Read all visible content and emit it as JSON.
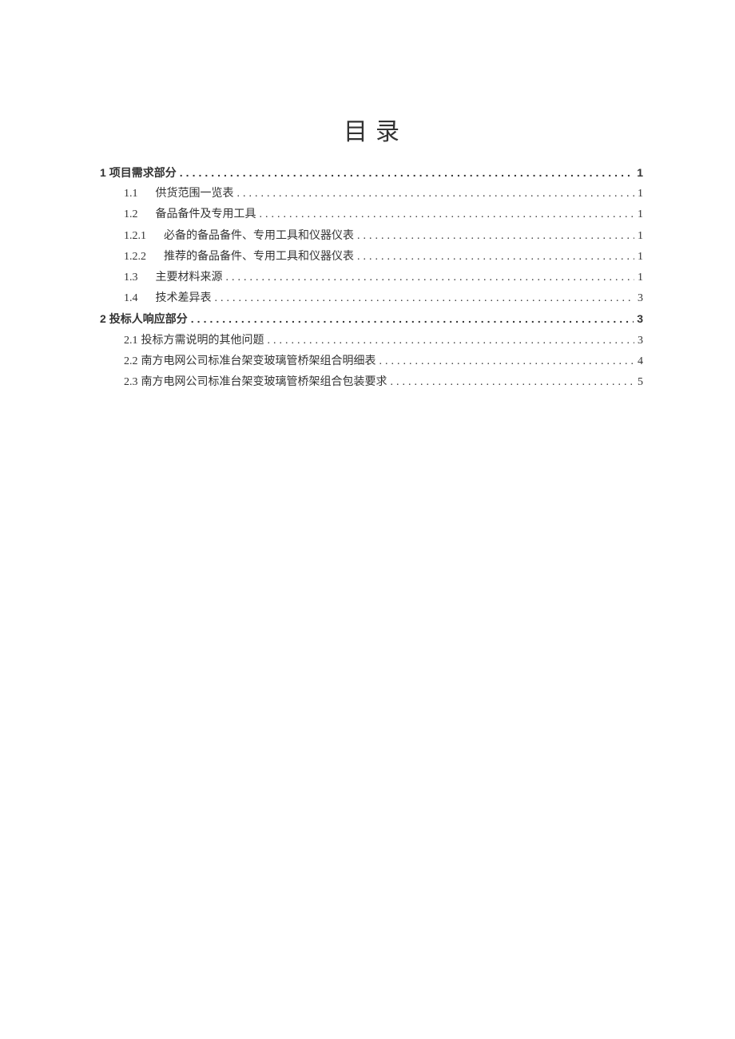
{
  "title": "目录",
  "entries": [
    {
      "number": "1",
      "text": "项目需求部分",
      "page": "1",
      "level": 0,
      "bold": true,
      "numGap": false
    },
    {
      "number": "1.1",
      "text": "供货范围一览表",
      "page": "1",
      "level": 1,
      "bold": false,
      "numGap": true
    },
    {
      "number": "1.2",
      "text": "备品备件及专用工具",
      "page": "1",
      "level": 1,
      "bold": false,
      "numGap": true
    },
    {
      "number": "1.2.1",
      "text": "必备的备品备件、专用工具和仪器仪表",
      "page": "1",
      "level": 2,
      "bold": false,
      "numGap": true
    },
    {
      "number": "1.2.2",
      "text": "推荐的备品备件、专用工具和仪器仪表",
      "page": "1",
      "level": 2,
      "bold": false,
      "numGap": true
    },
    {
      "number": "1.3",
      "text": "主要材料来源",
      "page": "1",
      "level": 1,
      "bold": false,
      "numGap": true
    },
    {
      "number": "1.4",
      "text": "技术差异表",
      "page": "3",
      "level": 1,
      "bold": false,
      "numGap": true
    },
    {
      "number": "2",
      "text": "投标人响应部分",
      "page": "3",
      "level": 0,
      "bold": true,
      "numGap": false
    },
    {
      "number": "2.1",
      "text": "投标方需说明的其他问题",
      "page": "3",
      "level": 1,
      "bold": false,
      "numGap": false
    },
    {
      "number": "2.2",
      "text": "南方电网公司标准台架变玻璃管桥架组合明细表",
      "page": "4",
      "level": 1,
      "bold": false,
      "numGap": false
    },
    {
      "number": "2.3",
      "text": "南方电网公司标准台架变玻璃管桥架组合包装要求",
      "page": "5",
      "level": 1,
      "bold": false,
      "numGap": false
    }
  ]
}
